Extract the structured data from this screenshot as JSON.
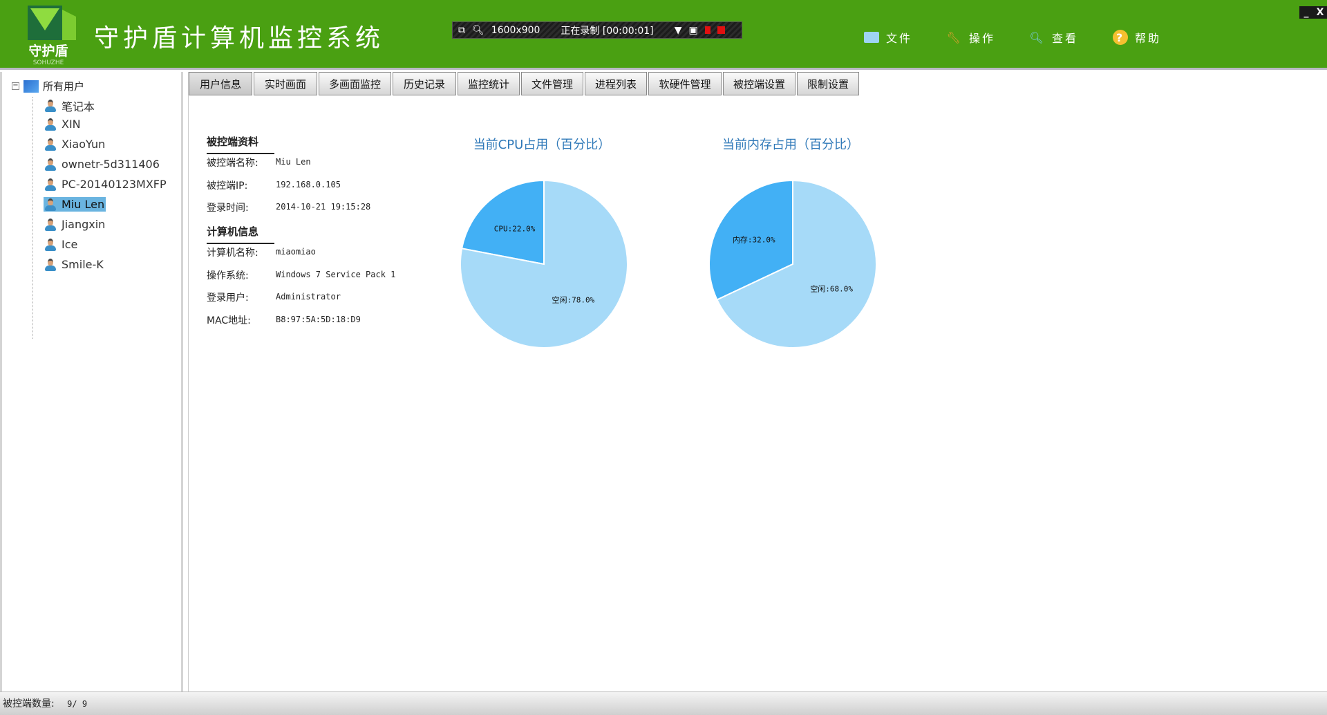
{
  "header": {
    "title": "守护盾计算机监控系统",
    "logo_text": "守护盾 SOHUZHE",
    "recorder": {
      "resolution": "1600x900",
      "status": "正在录制 [00:00:01]"
    },
    "menu": [
      {
        "label": "文件",
        "icon": "folder-icon"
      },
      {
        "label": "操作",
        "icon": "wrench-icon"
      },
      {
        "label": "查看",
        "icon": "magnifier-icon"
      },
      {
        "label": "帮助",
        "icon": "help-icon"
      }
    ]
  },
  "sidebar": {
    "root": "所有用户",
    "users": [
      "笔记本",
      "XIN",
      "XiaoYun",
      "ownetr-5d311406",
      "PC-20140123MXFP",
      "Miu Len",
      "Jiangxin",
      "Ice",
      "Smile-K"
    ],
    "selected": "Miu Len"
  },
  "tabs": [
    "用户信息",
    "实时画面",
    "多画面监控",
    "历史记录",
    "监控统计",
    "文件管理",
    "进程列表",
    "软硬件管理",
    "被控端设置",
    "限制设置"
  ],
  "active_tab": "用户信息",
  "client_info": {
    "heading": "被控端资料",
    "rows": [
      {
        "label": "被控端名称:",
        "value": "Miu Len"
      },
      {
        "label": "被控端IP:",
        "value": "192.168.0.105"
      },
      {
        "label": "登录时间:",
        "value": "2014-10-21 19:15:28"
      }
    ]
  },
  "computer_info": {
    "heading": "计算机信息",
    "rows": [
      {
        "label": "计算机名称:",
        "value": "miaomiao"
      },
      {
        "label": "操作系统:",
        "value": "Windows 7 Service Pack 1"
      },
      {
        "label": "登录用户:",
        "value": "Administrator"
      },
      {
        "label": "MAC地址:",
        "value": "B8:97:5A:5D:18:D9"
      }
    ]
  },
  "chart_data": [
    {
      "type": "pie",
      "title": "当前CPU占用（百分比）",
      "slices": [
        {
          "label": "CPU:22.0%",
          "name": "CPU",
          "value": 22.0,
          "color": "#42b0f5"
        },
        {
          "label": "空闲:78.0%",
          "name": "空闲",
          "value": 78.0,
          "color": "#a6daf8"
        }
      ]
    },
    {
      "type": "pie",
      "title": "当前内存占用（百分比）",
      "slices": [
        {
          "label": "内存:32.0%",
          "name": "内存",
          "value": 32.0,
          "color": "#42b0f5"
        },
        {
          "label": "空闲:68.0%",
          "name": "空闲",
          "value": 68.0,
          "color": "#a6daf8"
        }
      ]
    }
  ],
  "status": {
    "label": "被控端数量:",
    "count": "9/ 9"
  }
}
